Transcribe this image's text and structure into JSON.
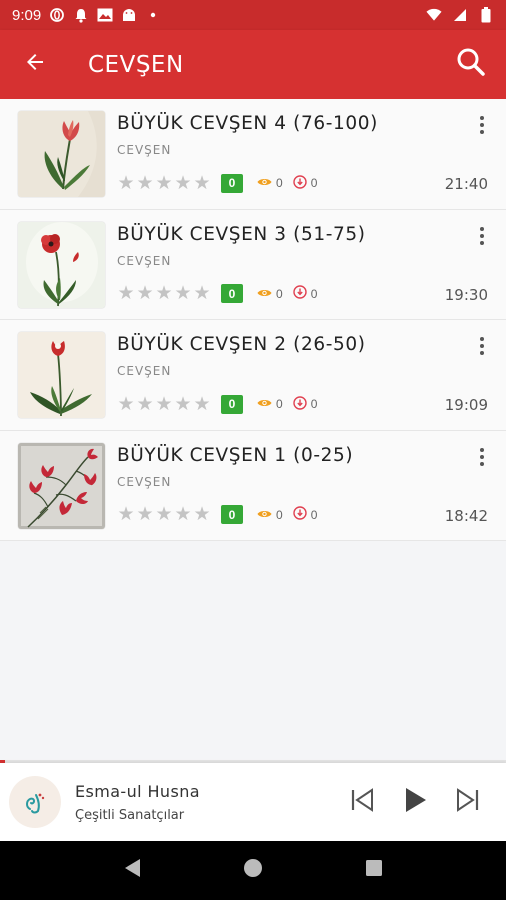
{
  "status_bar": {
    "time": "9:09",
    "icons_left": [
      "opera-icon",
      "notification-bell-icon",
      "image-icon",
      "android-icon",
      "dot-icon"
    ],
    "icons_right": [
      "wifi-icon",
      "cellular-icon",
      "battery-icon"
    ]
  },
  "app_bar": {
    "title": "CEVŞEN",
    "back_icon": "arrow-left-icon",
    "search_icon": "search-icon",
    "color": "#d63131"
  },
  "tracks": [
    {
      "title": "BÜYÜK CEVŞEN 4 (76-100)",
      "category": "CEVŞEN",
      "rating": 0,
      "badge": "0",
      "views": "0",
      "downloads": "0",
      "duration": "21:40",
      "thumbnail": "red-tulip"
    },
    {
      "title": "BÜYÜK CEVŞEN 3 (51-75)",
      "category": "CEVŞEN",
      "rating": 0,
      "badge": "0",
      "views": "0",
      "downloads": "0",
      "duration": "19:30",
      "thumbnail": "red-poppy"
    },
    {
      "title": "BÜYÜK CEVŞEN 2 (26-50)",
      "category": "CEVŞEN",
      "rating": 0,
      "badge": "0",
      "views": "0",
      "downloads": "0",
      "duration": "19:09",
      "thumbnail": "single-tulip"
    },
    {
      "title": "BÜYÜK CEVŞEN 1 (0-25)",
      "category": "CEVŞEN",
      "rating": 0,
      "badge": "0",
      "views": "0",
      "downloads": "0",
      "duration": "18:42",
      "thumbnail": "tulip-branch"
    }
  ],
  "player": {
    "title": "Esma-ul Husna",
    "artist": "Çeşitli Sanatçılar",
    "progress": 0.01,
    "controls": [
      "skip-previous-icon",
      "play-icon",
      "skip-next-icon"
    ]
  },
  "colors": {
    "accent": "#d63131",
    "status_bar": "#c82c2c",
    "badge": "#35a836",
    "views_icon": "#f0a020",
    "downloads_icon": "#e04050"
  }
}
